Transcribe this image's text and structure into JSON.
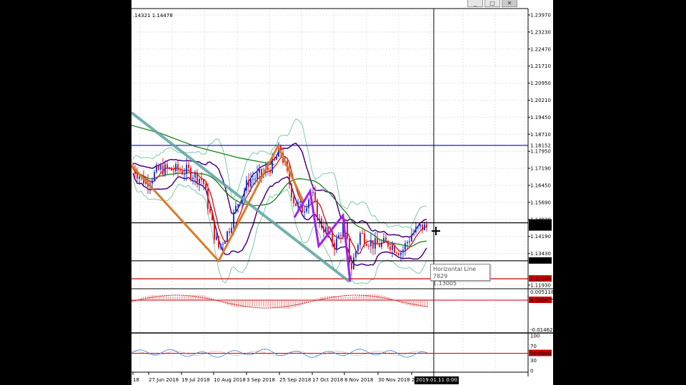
{
  "window": {
    "buttons": [
      "_",
      "□",
      "✕"
    ]
  },
  "header": {
    "ohlc_text": ".14321 1.14478"
  },
  "price_axis": {
    "ticks": [
      "1.23970",
      "1.23230",
      "1.22470",
      "1.21710",
      "1.20950",
      "1.20210",
      "1.19450",
      "1.18710",
      "1.17950",
      "1.17190",
      "1.16450",
      "1.15690",
      "1.14930",
      "1.14190",
      "1.13430",
      "1.11930"
    ],
    "current_price": "1.14478",
    "hline_high": "1.18152",
    "hline_low": "1.13005",
    "hline_red": "1.12204",
    "crosshair_price": "1.1470"
  },
  "macd_axis": {
    "ticks": [
      "0.005118",
      "-0.014627"
    ],
    "zero_label": "0.000075"
  },
  "rsi_axis": {
    "ticks": [
      "100",
      "70",
      "30",
      "0"
    ],
    "level_label": "50.0000"
  },
  "time_axis": {
    "labels": [
      "18",
      "27 Jun 2018",
      "19 Jul 2018",
      "10 Aug 2018",
      "3 Sep 2018",
      "25 Sep 2018",
      "17 Oct 2018",
      "8 Nov 2018",
      "30 Nov 2018",
      "24"
    ],
    "crosshair_time": "2019.01.11 0:00"
  },
  "tooltip": {
    "name": "Horizontal Line 7829",
    "value": "1.13005"
  },
  "colors": {
    "bull": "#1f3fd0",
    "bear": "#e02020",
    "bollinger": "#7fc7a5",
    "envelope": "#4b0082",
    "ma_green": "#1b7f1b",
    "ma_red": "#d01010",
    "trend_teal": "#5aa3a0",
    "zigzag_orange": "#d87b2a",
    "zigzag_purple": "#a020f0",
    "hline_blue": "#0000cc",
    "hline_red": "#cc0000"
  }
}
